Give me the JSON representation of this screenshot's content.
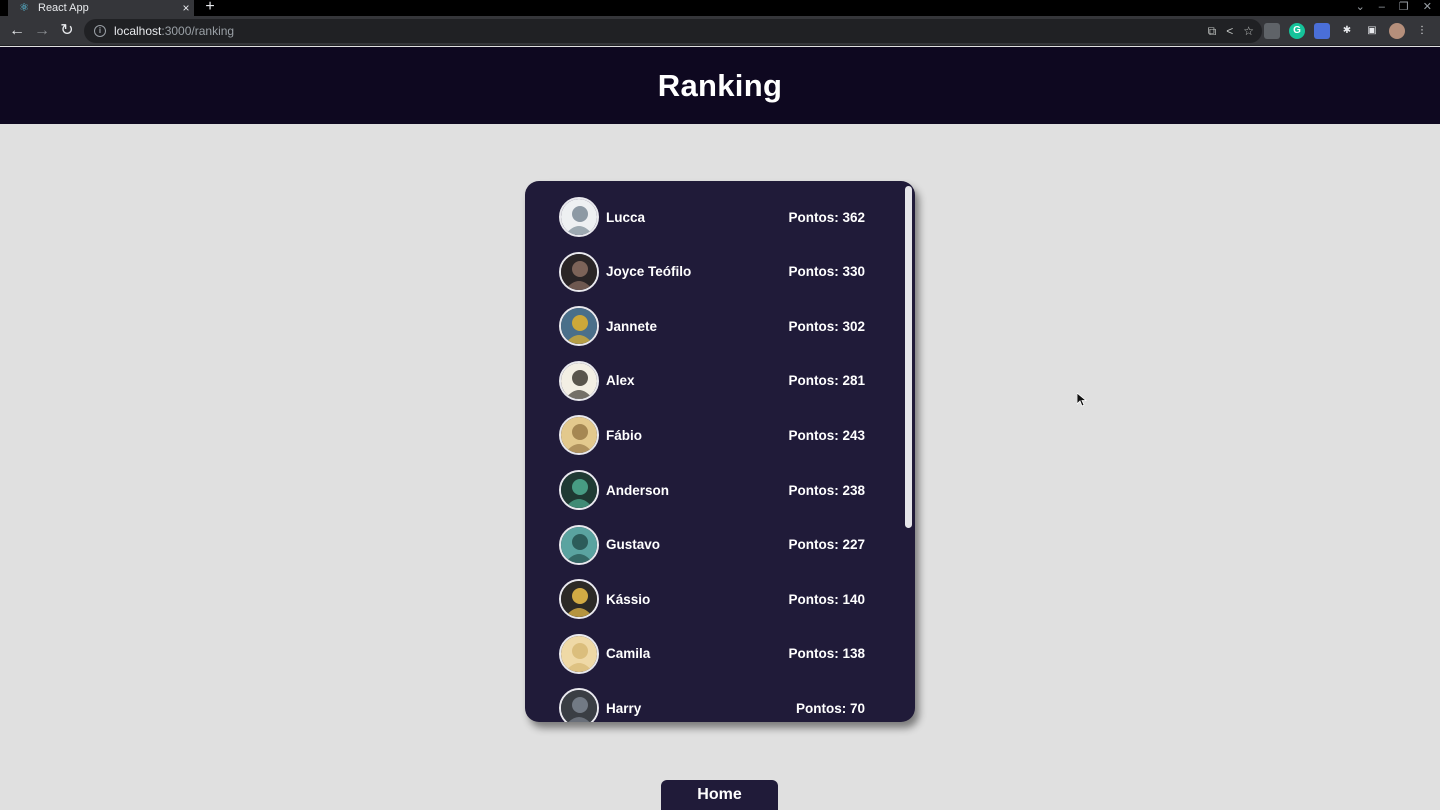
{
  "browser": {
    "tab_title": "React App",
    "tab_close": "×",
    "new_tab": "+",
    "back": "←",
    "forward": "→",
    "reload": "↻",
    "url_host": "localhost",
    "url_path": ":3000/ranking",
    "info": "i"
  },
  "header": {
    "title": "Ranking"
  },
  "ranking": [
    {
      "name": "Lucca",
      "points": "Pontos: 362",
      "avatar": "dragon-sketch",
      "color_bg": "#eef0f2",
      "color_fg": "#7b8a96"
    },
    {
      "name": "Joyce Teófilo",
      "points": "Pontos: 330",
      "avatar": "dark-figure",
      "color_bg": "#2a2526",
      "color_fg": "#8b6e62"
    },
    {
      "name": "Jannete",
      "points": "Pontos: 302",
      "avatar": "yellow-bird",
      "color_bg": "#4a6f8a",
      "color_fg": "#e4b32a"
    },
    {
      "name": "Alex",
      "points": "Pontos: 281",
      "avatar": "bat-sketch",
      "color_bg": "#f3efe4",
      "color_fg": "#3d3a33"
    },
    {
      "name": "Fábio",
      "points": "Pontos: 243",
      "avatar": "golden-art",
      "color_bg": "#e3c98d",
      "color_fg": "#9a7b48"
    },
    {
      "name": "Anderson",
      "points": "Pontos: 238",
      "avatar": "green-leaves",
      "color_bg": "#1f3a33",
      "color_fg": "#4fae92"
    },
    {
      "name": "Gustavo",
      "points": "Pontos: 227",
      "avatar": "teal-forest",
      "color_bg": "#5aa3a0",
      "color_fg": "#24504d"
    },
    {
      "name": "Kássio",
      "points": "Pontos: 140",
      "avatar": "blond-character",
      "color_bg": "#2c2a26",
      "color_fg": "#f0c24a"
    },
    {
      "name": "Camila",
      "points": "Pontos: 138",
      "avatar": "cream-pattern",
      "color_bg": "#efd9a6",
      "color_fg": "#d7b874"
    },
    {
      "name": "Harry",
      "points": "Pontos: 70",
      "avatar": "armor-figure",
      "color_bg": "#3a3e44",
      "color_fg": "#7d8590"
    }
  ],
  "home_button": {
    "label": "Home"
  },
  "colors": {
    "header_bg": "#0e0820",
    "card_bg": "#201b39",
    "page_bg": "#e0e0e0"
  }
}
